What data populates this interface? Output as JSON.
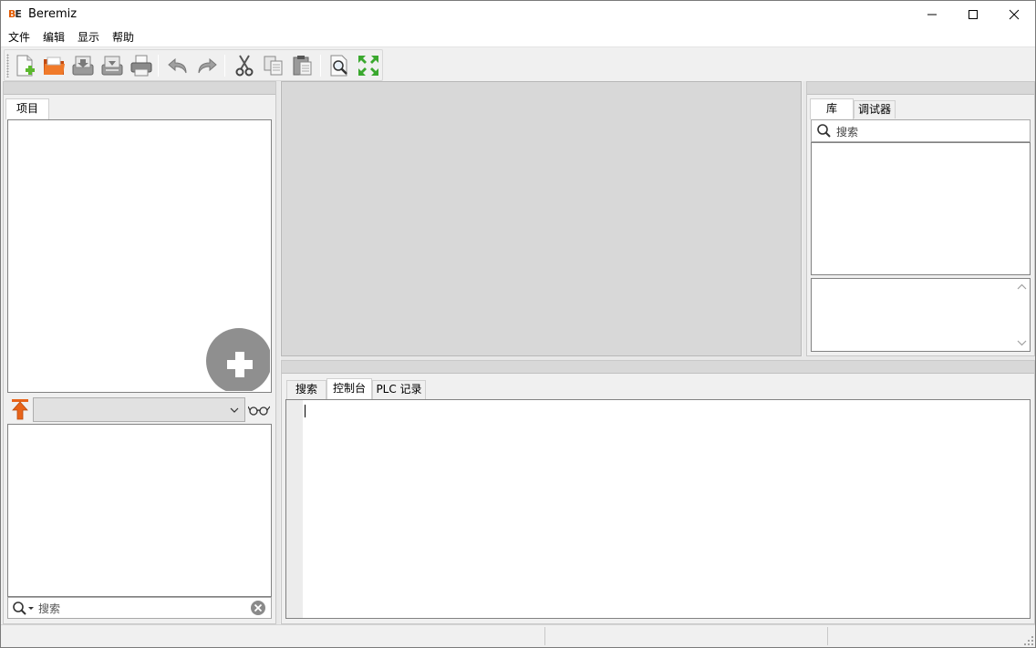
{
  "window": {
    "title": "Beremiz",
    "logo_text_b": "B",
    "logo_text_e": "E"
  },
  "menu": {
    "items": [
      "文件",
      "编辑",
      "显示",
      "帮助"
    ]
  },
  "toolbar": {
    "buttons": [
      "new-file-icon",
      "open-folder-icon",
      "save-icon",
      "save-as-icon",
      "print-icon",
      "undo-icon",
      "redo-icon",
      "cut-icon",
      "copy-icon",
      "paste-icon",
      "find-icon",
      "fullscreen-icon"
    ]
  },
  "left_panel": {
    "project_tab": "项目",
    "search_placeholder": "搜索",
    "variable_select_value": ""
  },
  "right_panel": {
    "tabs": [
      "库",
      "调试器"
    ],
    "search_placeholder": "搜索"
  },
  "bottom_panel": {
    "tabs": [
      "搜索",
      "控制台",
      "PLC 记录"
    ],
    "active_tab": "控制台"
  },
  "colors": {
    "accent_orange": "#e8641a",
    "fab_gray": "#8f8f8f",
    "pane_gray": "#d8d8d8"
  }
}
